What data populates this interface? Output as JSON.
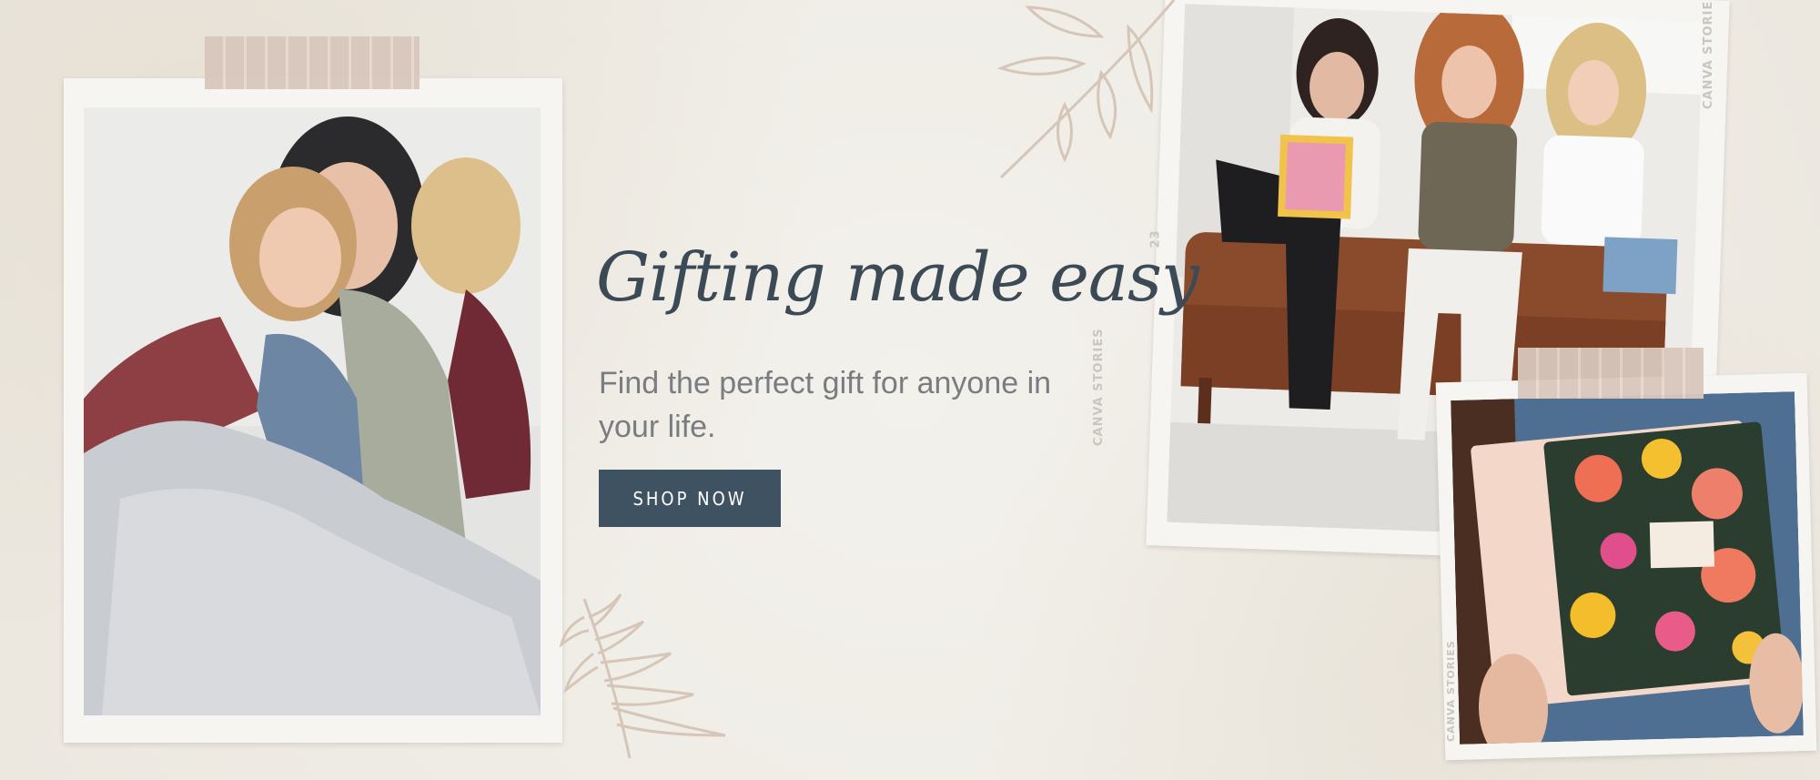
{
  "hero": {
    "headline": "Gifting made easy",
    "subtext": "Find the perfect gift for anyone in your life.",
    "cta_label": "SHOP NOW"
  },
  "photo_stamps": {
    "brand": "CANVA STORIES",
    "number": "23"
  },
  "colors": {
    "background": "#efebe4",
    "headline": "#3b4a55",
    "subtext": "#7a7d80",
    "button": "#3f5261",
    "tape": "#d8c7bc",
    "leaf": "#d6c6b8"
  },
  "icons": {
    "top_leaf": "leaf-branch-icon",
    "bottom_leaf": "palm-leaf-icon"
  }
}
